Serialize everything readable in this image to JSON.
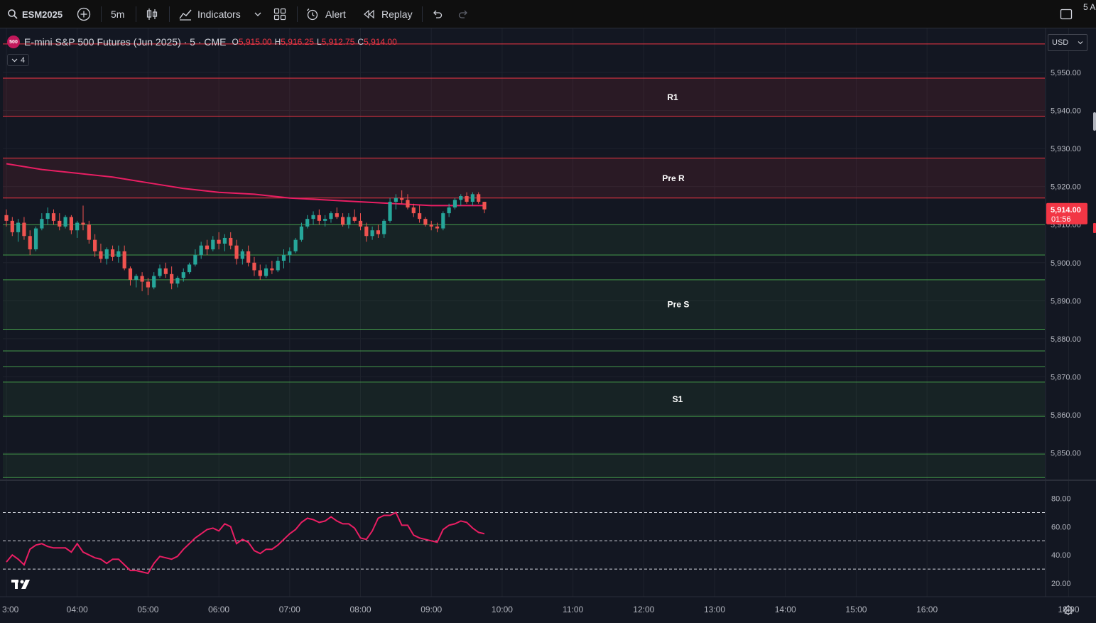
{
  "toolbar": {
    "symbol": "ESM2025",
    "interval": "5m",
    "indicators_label": "Indicators",
    "alert_label": "Alert",
    "replay_label": "Replay",
    "right_edge_text": "5 A"
  },
  "legend": {
    "symbol_badge": "500",
    "title": "E-mini S&P 500 Futures (Jun 2025) · 5 · CME",
    "open_key": "O",
    "open": "5,915.00",
    "high_key": "H",
    "high": "5,916.25",
    "low_key": "L",
    "low": "5,912.75",
    "close_key": "C",
    "close": "5,914.00",
    "indicators_count": "4"
  },
  "currency": "USD",
  "price_scale": {
    "labels": [
      "5,950.00",
      "5,940.00",
      "5,930.00",
      "5,920.00",
      "5,910.00",
      "5,900.00",
      "5,890.00",
      "5,880.00",
      "5,870.00",
      "5,860.00",
      "5,850.00"
    ],
    "current_price": "5,914.00",
    "countdown": "01:56"
  },
  "rsi_scale": {
    "labels": [
      "80.00",
      "60.00",
      "40.00",
      "20.00"
    ]
  },
  "time_axis": {
    "labels": [
      "3:00",
      "04:00",
      "05:00",
      "06:00",
      "07:00",
      "08:00",
      "09:00",
      "10:00",
      "11:00",
      "12:00",
      "13:00",
      "14:00",
      "15:00",
      "16:00",
      "18:00"
    ]
  },
  "zones": {
    "r1": "R1",
    "pre_r": "Pre R",
    "pre_s": "Pre S",
    "s1": "S1"
  },
  "colors": {
    "background": "#131722",
    "up": "#26a69a",
    "down": "#ef5350",
    "ma": "#e91e63",
    "resistance_line": "#f23645",
    "support_line": "#4caf50",
    "rsi": "#e91e63"
  },
  "chart_data": [
    {
      "type": "candlestick",
      "interval": "5m",
      "price_range": [
        5842,
        5960
      ],
      "time_range": [
        "03:00",
        "18:30"
      ],
      "candles": [
        [
          "03:00",
          5912.5,
          5914.0,
          5909.5,
          5911.0
        ],
        [
          "03:05",
          5911.0,
          5912.0,
          5907.0,
          5908.0
        ],
        [
          "03:10",
          5908.0,
          5911.5,
          5905.5,
          5910.5
        ],
        [
          "03:15",
          5910.5,
          5912.0,
          5906.0,
          5907.0
        ],
        [
          "03:20",
          5907.0,
          5908.5,
          5902.0,
          5903.5
        ],
        [
          "03:25",
          5903.5,
          5909.5,
          5903.0,
          5909.0
        ],
        [
          "03:30",
          5909.0,
          5913.0,
          5908.5,
          5911.5
        ],
        [
          "03:35",
          5911.5,
          5914.5,
          5910.0,
          5913.0
        ],
        [
          "03:40",
          5913.0,
          5914.0,
          5910.0,
          5911.0
        ],
        [
          "03:45",
          5911.0,
          5913.0,
          5908.5,
          5909.5
        ],
        [
          "03:50",
          5909.5,
          5912.5,
          5909.0,
          5912.0
        ],
        [
          "03:55",
          5912.0,
          5912.5,
          5907.5,
          5908.5
        ],
        [
          "04:00",
          5908.5,
          5911.0,
          5906.5,
          5910.5
        ],
        [
          "04:05",
          5910.5,
          5915.0,
          5908.5,
          5910.0
        ],
        [
          "04:10",
          5910.0,
          5911.0,
          5905.0,
          5906.0
        ],
        [
          "04:15",
          5906.0,
          5907.5,
          5901.5,
          5903.0
        ],
        [
          "04:20",
          5903.0,
          5905.0,
          5900.0,
          5901.0
        ],
        [
          "04:25",
          5901.0,
          5904.0,
          5899.5,
          5903.5
        ],
        [
          "04:30",
          5903.5,
          5904.5,
          5900.5,
          5901.5
        ],
        [
          "04:35",
          5901.5,
          5904.5,
          5900.0,
          5903.0
        ],
        [
          "04:40",
          5903.0,
          5904.5,
          5898.0,
          5898.5
        ],
        [
          "04:45",
          5898.5,
          5899.0,
          5894.0,
          5895.5
        ],
        [
          "04:50",
          5895.5,
          5897.0,
          5893.5,
          5896.5
        ],
        [
          "04:55",
          5896.5,
          5897.5,
          5892.5,
          5895.0
        ],
        [
          "05:00",
          5895.0,
          5896.0,
          5891.5,
          5893.5
        ],
        [
          "05:05",
          5893.5,
          5897.5,
          5893.0,
          5896.5
        ],
        [
          "05:10",
          5896.5,
          5899.5,
          5896.0,
          5898.5
        ],
        [
          "05:15",
          5898.5,
          5900.0,
          5896.0,
          5897.0
        ],
        [
          "05:20",
          5897.0,
          5899.0,
          5893.0,
          5894.5
        ],
        [
          "05:25",
          5894.5,
          5896.5,
          5893.5,
          5896.0
        ],
        [
          "05:30",
          5896.0,
          5898.5,
          5895.0,
          5897.5
        ],
        [
          "05:35",
          5897.5,
          5900.0,
          5897.0,
          5899.5
        ],
        [
          "05:40",
          5899.5,
          5903.5,
          5899.0,
          5902.0
        ],
        [
          "05:45",
          5902.0,
          5905.5,
          5901.0,
          5904.5
        ],
        [
          "05:50",
          5904.5,
          5906.0,
          5902.0,
          5903.5
        ],
        [
          "05:55",
          5903.5,
          5907.0,
          5903.0,
          5906.0
        ],
        [
          "06:00",
          5906.0,
          5908.0,
          5903.5,
          5905.0
        ],
        [
          "06:05",
          5905.0,
          5907.5,
          5903.0,
          5906.5
        ],
        [
          "06:10",
          5906.5,
          5908.0,
          5903.5,
          5904.5
        ],
        [
          "06:15",
          5904.5,
          5906.0,
          5899.5,
          5901.0
        ],
        [
          "06:20",
          5901.0,
          5903.5,
          5899.5,
          5903.0
        ],
        [
          "06:25",
          5903.0,
          5904.5,
          5899.0,
          5900.0
        ],
        [
          "06:30",
          5900.0,
          5901.5,
          5896.5,
          5898.0
        ],
        [
          "06:35",
          5898.0,
          5899.5,
          5895.5,
          5896.5
        ],
        [
          "06:40",
          5896.5,
          5899.5,
          5896.0,
          5898.5
        ],
        [
          "06:45",
          5898.5,
          5900.5,
          5897.0,
          5898.0
        ],
        [
          "06:50",
          5898.0,
          5901.5,
          5897.5,
          5900.5
        ],
        [
          "06:55",
          5900.5,
          5903.5,
          5898.5,
          5902.0
        ],
        [
          "07:00",
          5902.0,
          5904.0,
          5900.0,
          5903.0
        ],
        [
          "07:05",
          5903.0,
          5906.5,
          5902.5,
          5906.0
        ],
        [
          "07:10",
          5906.0,
          5910.5,
          5905.5,
          5909.5
        ],
        [
          "07:15",
          5909.5,
          5912.5,
          5909.0,
          5911.5
        ],
        [
          "07:20",
          5911.5,
          5913.5,
          5910.0,
          5912.5
        ],
        [
          "07:25",
          5912.5,
          5914.0,
          5910.0,
          5911.0
        ],
        [
          "07:30",
          5911.0,
          5912.5,
          5909.5,
          5911.5
        ],
        [
          "07:35",
          5911.5,
          5913.5,
          5910.5,
          5913.0
        ],
        [
          "07:40",
          5913.0,
          5914.5,
          5911.5,
          5912.0
        ],
        [
          "07:45",
          5912.0,
          5913.0,
          5909.5,
          5910.0
        ],
        [
          "07:50",
          5910.0,
          5913.0,
          5909.0,
          5912.0
        ],
        [
          "07:55",
          5912.0,
          5914.0,
          5910.5,
          5911.0
        ],
        [
          "08:00",
          5911.0,
          5913.0,
          5908.5,
          5909.5
        ],
        [
          "08:05",
          5909.5,
          5910.5,
          5905.5,
          5907.0
        ],
        [
          "08:10",
          5907.0,
          5909.5,
          5906.0,
          5908.5
        ],
        [
          "08:15",
          5908.5,
          5910.0,
          5906.5,
          5907.5
        ],
        [
          "08:20",
          5907.5,
          5911.5,
          5906.5,
          5911.0
        ],
        [
          "08:25",
          5911.0,
          5917.0,
          5910.5,
          5916.0
        ],
        [
          "08:30",
          5916.0,
          5918.0,
          5914.0,
          5917.0
        ],
        [
          "08:35",
          5917.0,
          5919.0,
          5915.5,
          5916.5
        ],
        [
          "08:40",
          5916.5,
          5918.0,
          5914.0,
          5914.5
        ],
        [
          "08:45",
          5914.5,
          5915.5,
          5912.0,
          5913.0
        ],
        [
          "08:50",
          5913.0,
          5915.0,
          5910.5,
          5911.5
        ],
        [
          "08:55",
          5911.5,
          5912.0,
          5909.5,
          5910.0
        ],
        [
          "09:00",
          5910.0,
          5911.0,
          5908.5,
          5909.5
        ],
        [
          "09:05",
          5909.5,
          5910.5,
          5908.0,
          5909.0
        ],
        [
          "09:10",
          5909.0,
          5913.5,
          5908.5,
          5913.0
        ],
        [
          "09:15",
          5913.0,
          5915.5,
          5912.0,
          5914.5
        ],
        [
          "09:20",
          5914.5,
          5917.0,
          5914.0,
          5916.5
        ],
        [
          "09:25",
          5916.5,
          5918.0,
          5915.0,
          5917.5
        ],
        [
          "09:30",
          5917.5,
          5918.5,
          5915.5,
          5916.0
        ],
        [
          "09:35",
          5916.0,
          5918.5,
          5915.0,
          5918.0
        ],
        [
          "09:40",
          5918.0,
          5918.5,
          5915.5,
          5916.0
        ],
        [
          "09:45",
          5916.0,
          5916.0,
          5913.0,
          5914.0
        ]
      ],
      "moving_average": {
        "points": [
          [
            "03:00",
            5926.0
          ],
          [
            "03:30",
            5924.5
          ],
          [
            "04:00",
            5923.5
          ],
          [
            "04:30",
            5922.5
          ],
          [
            "05:00",
            5921.0
          ],
          [
            "05:30",
            5919.5
          ],
          [
            "06:00",
            5918.5
          ],
          [
            "06:30",
            5918.0
          ],
          [
            "07:00",
            5917.0
          ],
          [
            "07:30",
            5916.5
          ],
          [
            "08:00",
            5916.0
          ],
          [
            "08:30",
            5915.5
          ],
          [
            "09:00",
            5915.0
          ],
          [
            "09:45",
            5915.0
          ]
        ]
      },
      "resistance_lines": [
        5957.5,
        5948.5,
        5938.5,
        5927.5,
        5917.0
      ],
      "support_lines": [
        5910.0,
        5902.0,
        5895.5,
        5882.5,
        5876.8,
        5872.7,
        5868.6,
        5859.6,
        5849.7,
        5843.5
      ],
      "resistance_zones": [
        [
          5938.5,
          5948.5
        ],
        [
          5917.0,
          5927.5
        ]
      ],
      "support_zones": [
        [
          5902.0,
          5910.0
        ],
        [
          5882.5,
          5895.5
        ],
        [
          5859.6,
          5868.6
        ],
        [
          5843.5,
          5849.7
        ]
      ]
    },
    {
      "type": "line",
      "name": "RSI",
      "ylim": [
        10,
        90
      ],
      "levels": [
        70,
        50,
        30
      ],
      "points": [
        [
          "03:00",
          35
        ],
        [
          "03:05",
          40
        ],
        [
          "03:10",
          37
        ],
        [
          "03:15",
          33
        ],
        [
          "03:20",
          44
        ],
        [
          "03:25",
          47
        ],
        [
          "03:30",
          48
        ],
        [
          "03:35",
          46
        ],
        [
          "03:40",
          45
        ],
        [
          "03:45",
          45
        ],
        [
          "03:50",
          45
        ],
        [
          "03:55",
          42
        ],
        [
          "04:00",
          48
        ],
        [
          "04:05",
          42
        ],
        [
          "04:10",
          40
        ],
        [
          "04:15",
          38
        ],
        [
          "04:20",
          37
        ],
        [
          "04:25",
          34
        ],
        [
          "04:30",
          37
        ],
        [
          "04:35",
          37
        ],
        [
          "04:40",
          33
        ],
        [
          "04:45",
          29
        ],
        [
          "04:50",
          29
        ],
        [
          "04:55",
          28
        ],
        [
          "05:00",
          27
        ],
        [
          "05:05",
          34
        ],
        [
          "05:10",
          39
        ],
        [
          "05:15",
          38
        ],
        [
          "05:20",
          37
        ],
        [
          "05:25",
          39
        ],
        [
          "05:30",
          44
        ],
        [
          "05:35",
          48
        ],
        [
          "05:40",
          52
        ],
        [
          "05:45",
          55
        ],
        [
          "05:50",
          58
        ],
        [
          "05:55",
          59
        ],
        [
          "06:00",
          57
        ],
        [
          "06:05",
          62
        ],
        [
          "06:10",
          60
        ],
        [
          "06:15",
          48
        ],
        [
          "06:20",
          51
        ],
        [
          "06:25",
          49
        ],
        [
          "06:30",
          43
        ],
        [
          "06:35",
          41
        ],
        [
          "06:40",
          44
        ],
        [
          "06:45",
          44
        ],
        [
          "06:50",
          47
        ],
        [
          "06:55",
          51
        ],
        [
          "07:00",
          55
        ],
        [
          "07:05",
          58
        ],
        [
          "07:10",
          63
        ],
        [
          "07:15",
          66
        ],
        [
          "07:20",
          65
        ],
        [
          "07:25",
          63
        ],
        [
          "07:30",
          64
        ],
        [
          "07:35",
          67
        ],
        [
          "07:40",
          64
        ],
        [
          "07:45",
          62
        ],
        [
          "07:50",
          62
        ],
        [
          "07:55",
          59
        ],
        [
          "08:00",
          52
        ],
        [
          "08:05",
          51
        ],
        [
          "08:10",
          57
        ],
        [
          "08:15",
          66
        ],
        [
          "08:20",
          68
        ],
        [
          "08:25",
          68
        ],
        [
          "08:30",
          70
        ],
        [
          "08:35",
          61
        ],
        [
          "08:40",
          61
        ],
        [
          "08:45",
          54
        ],
        [
          "08:50",
          52
        ],
        [
          "08:55",
          51
        ],
        [
          "09:00",
          50
        ],
        [
          "09:05",
          49
        ],
        [
          "09:10",
          58
        ],
        [
          "09:15",
          61
        ],
        [
          "09:20",
          62
        ],
        [
          "09:25",
          64
        ],
        [
          "09:30",
          63
        ],
        [
          "09:35",
          59
        ],
        [
          "09:40",
          56
        ],
        [
          "09:45",
          55
        ]
      ]
    }
  ]
}
